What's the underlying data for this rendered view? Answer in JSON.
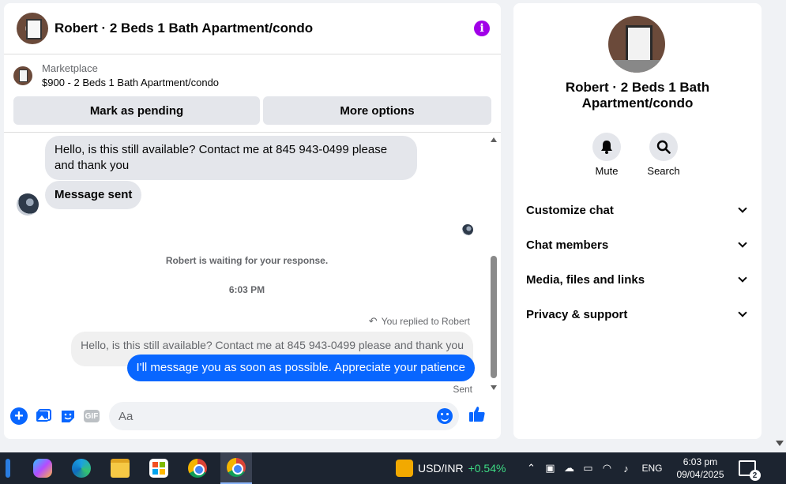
{
  "chat": {
    "title": "Robert · 2 Beds 1 Bath Apartment/condo",
    "marketplace_label": "Marketplace",
    "listing": "$900 - 2 Beds 1 Bath Apartment/condo",
    "mark_pending": "Mark as pending",
    "more_options": "More options"
  },
  "messages": {
    "incoming_1": "Hello, is this still available? Contact me at 845 943-0499 please and thank you",
    "incoming_2": "Message sent",
    "waiting": "Robert is waiting for your response.",
    "timestamp": "6:03 PM",
    "replied_label": "You replied to Robert",
    "quoted": "Hello, is this still available? Contact me at 845 943-0499 please and thank you",
    "outgoing": "I'll message you as soon as possible. Appreciate your patience",
    "status": "Sent"
  },
  "composer": {
    "placeholder": "Aa",
    "gif_label": "GIF"
  },
  "info": {
    "title": "Robert · 2 Beds 1 Bath Apartment/condo",
    "mute_label": "Mute",
    "search_label": "Search",
    "sections": [
      "Customize chat",
      "Chat members",
      "Media, files and links",
      "Privacy & support"
    ]
  },
  "taskbar": {
    "stock_name": "USD/INR",
    "stock_change": "+0.54%",
    "language": "ENG",
    "time": "6:03 pm",
    "date": "09/04/2025",
    "notification_count": "2"
  },
  "colors": {
    "accent": "#0866ff",
    "info_purple": "#a100e8",
    "bubble_gray": "#e4e6eb",
    "stock_green": "#3ddc84"
  }
}
